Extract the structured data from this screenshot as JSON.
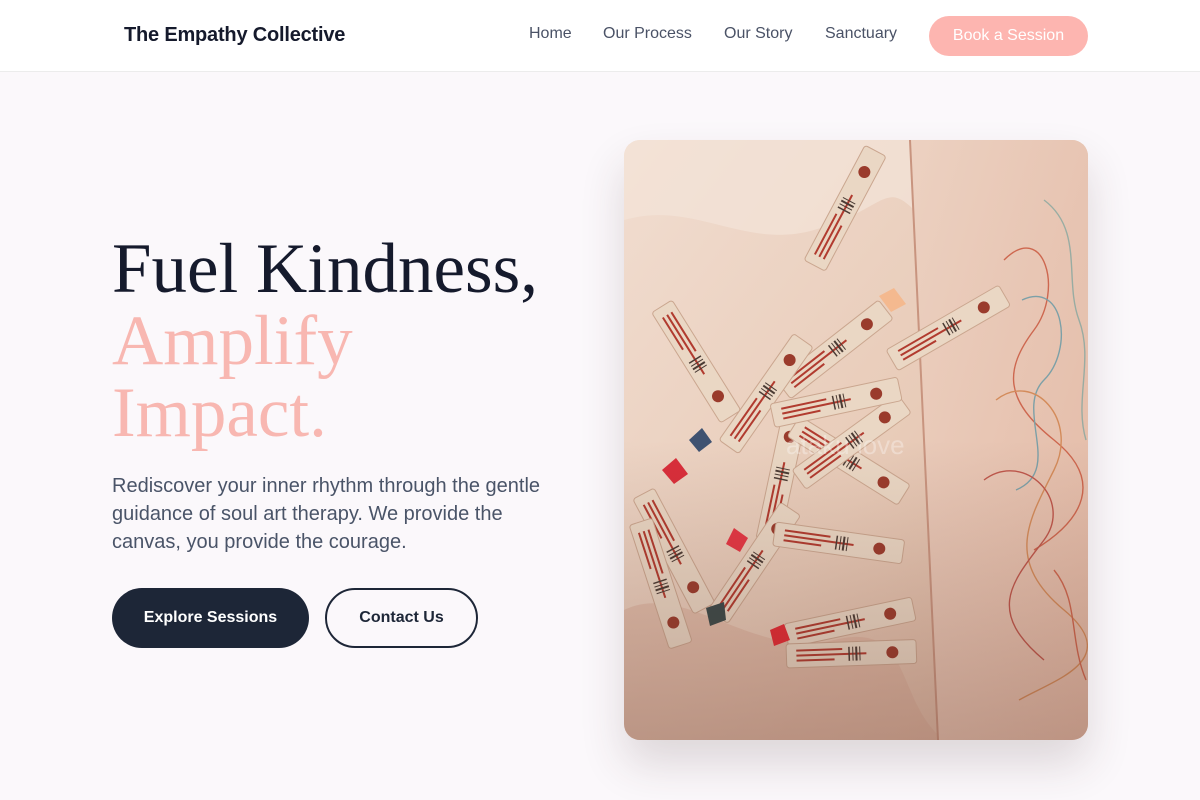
{
  "header": {
    "logo": "The Empathy Collective",
    "nav": [
      "Home",
      "Our Process",
      "Our Story",
      "Sanctuary"
    ],
    "cta": "Book a Session"
  },
  "hero": {
    "headline_line1": "Fuel Kindness,",
    "headline_line2": "Amplify",
    "headline_line3": "Impact.",
    "lead": "Rediscover your inner rhythm through the gentle guidance of soul art therapy. We provide the canvas, you provide the courage.",
    "primary_button": "Explore Sessions",
    "secondary_button": "Contact Us"
  },
  "image": {
    "subject": "pile of oil pastels beside a scribbled drawing",
    "watermark": "ataku love"
  },
  "colors": {
    "navy": "#1d2637",
    "accent_pink": "#f8b7b1",
    "cta_pink": "#fdb5b0",
    "page_bg": "#fbf8fb"
  }
}
